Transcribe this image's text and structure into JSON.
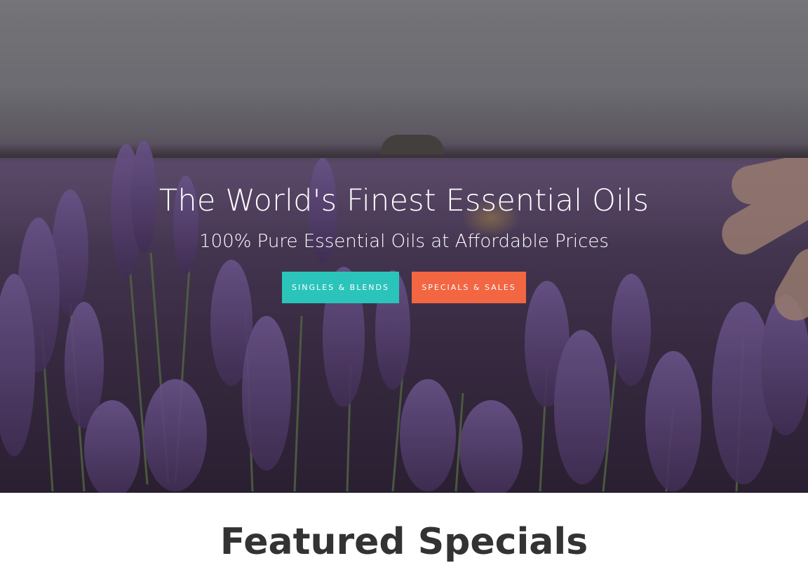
{
  "hero": {
    "title": "The World's Finest Essential Oils",
    "subtitle": "100% Pure Essential Oils at Affordable Prices",
    "buttons": [
      {
        "label": "SINGLES & BLENDS",
        "color": "#2bc4bb"
      },
      {
        "label": "SPECIALS & SALES",
        "color": "#f26642"
      }
    ],
    "background_image": "lavender-field-photo"
  },
  "featured": {
    "heading": "Featured Specials"
  }
}
